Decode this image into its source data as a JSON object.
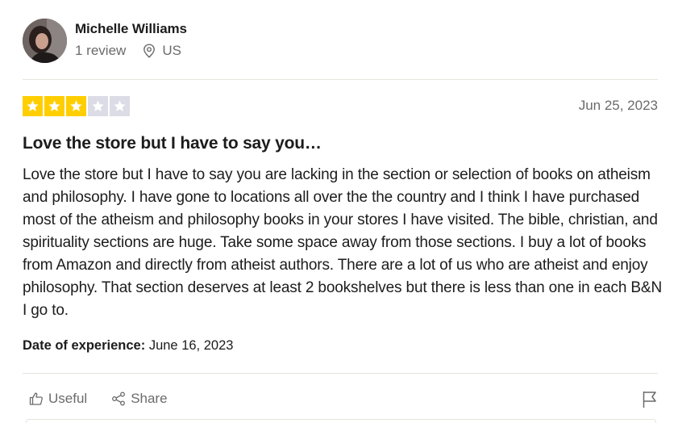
{
  "reviewer": {
    "name": "Michelle Williams",
    "review_count": "1 review",
    "country": "US",
    "avatar_icon": "user-photo"
  },
  "review": {
    "rating": 3,
    "max_rating": 5,
    "star_color": "#ffce00",
    "empty_star_color": "#dcdce6",
    "date": "Jun 25, 2023",
    "title": "Love the store but I have to say you…",
    "body": "Love the store but I have to say you are lacking in the section or selection of books on atheism and philosophy. I have gone to locations all over the the country and I think I have purchased most of the atheism and philosophy books in your stores I have visited. The bible, christian, and spirituality sections are huge. Take some space away from those sections. I buy a lot of books from Amazon and directly from atheist authors. There are a lot of us who are atheist and enjoy philosophy. That section deserves at least 2 bookshelves but there is less than one in each B&N I go to.",
    "experience_label": "Date of experience:",
    "experience_date": "June 16, 2023"
  },
  "actions": {
    "useful_label": "Useful",
    "share_label": "Share",
    "useful_icon": "thumbs-up-icon",
    "share_icon": "share-icon",
    "flag_icon": "flag-icon"
  }
}
